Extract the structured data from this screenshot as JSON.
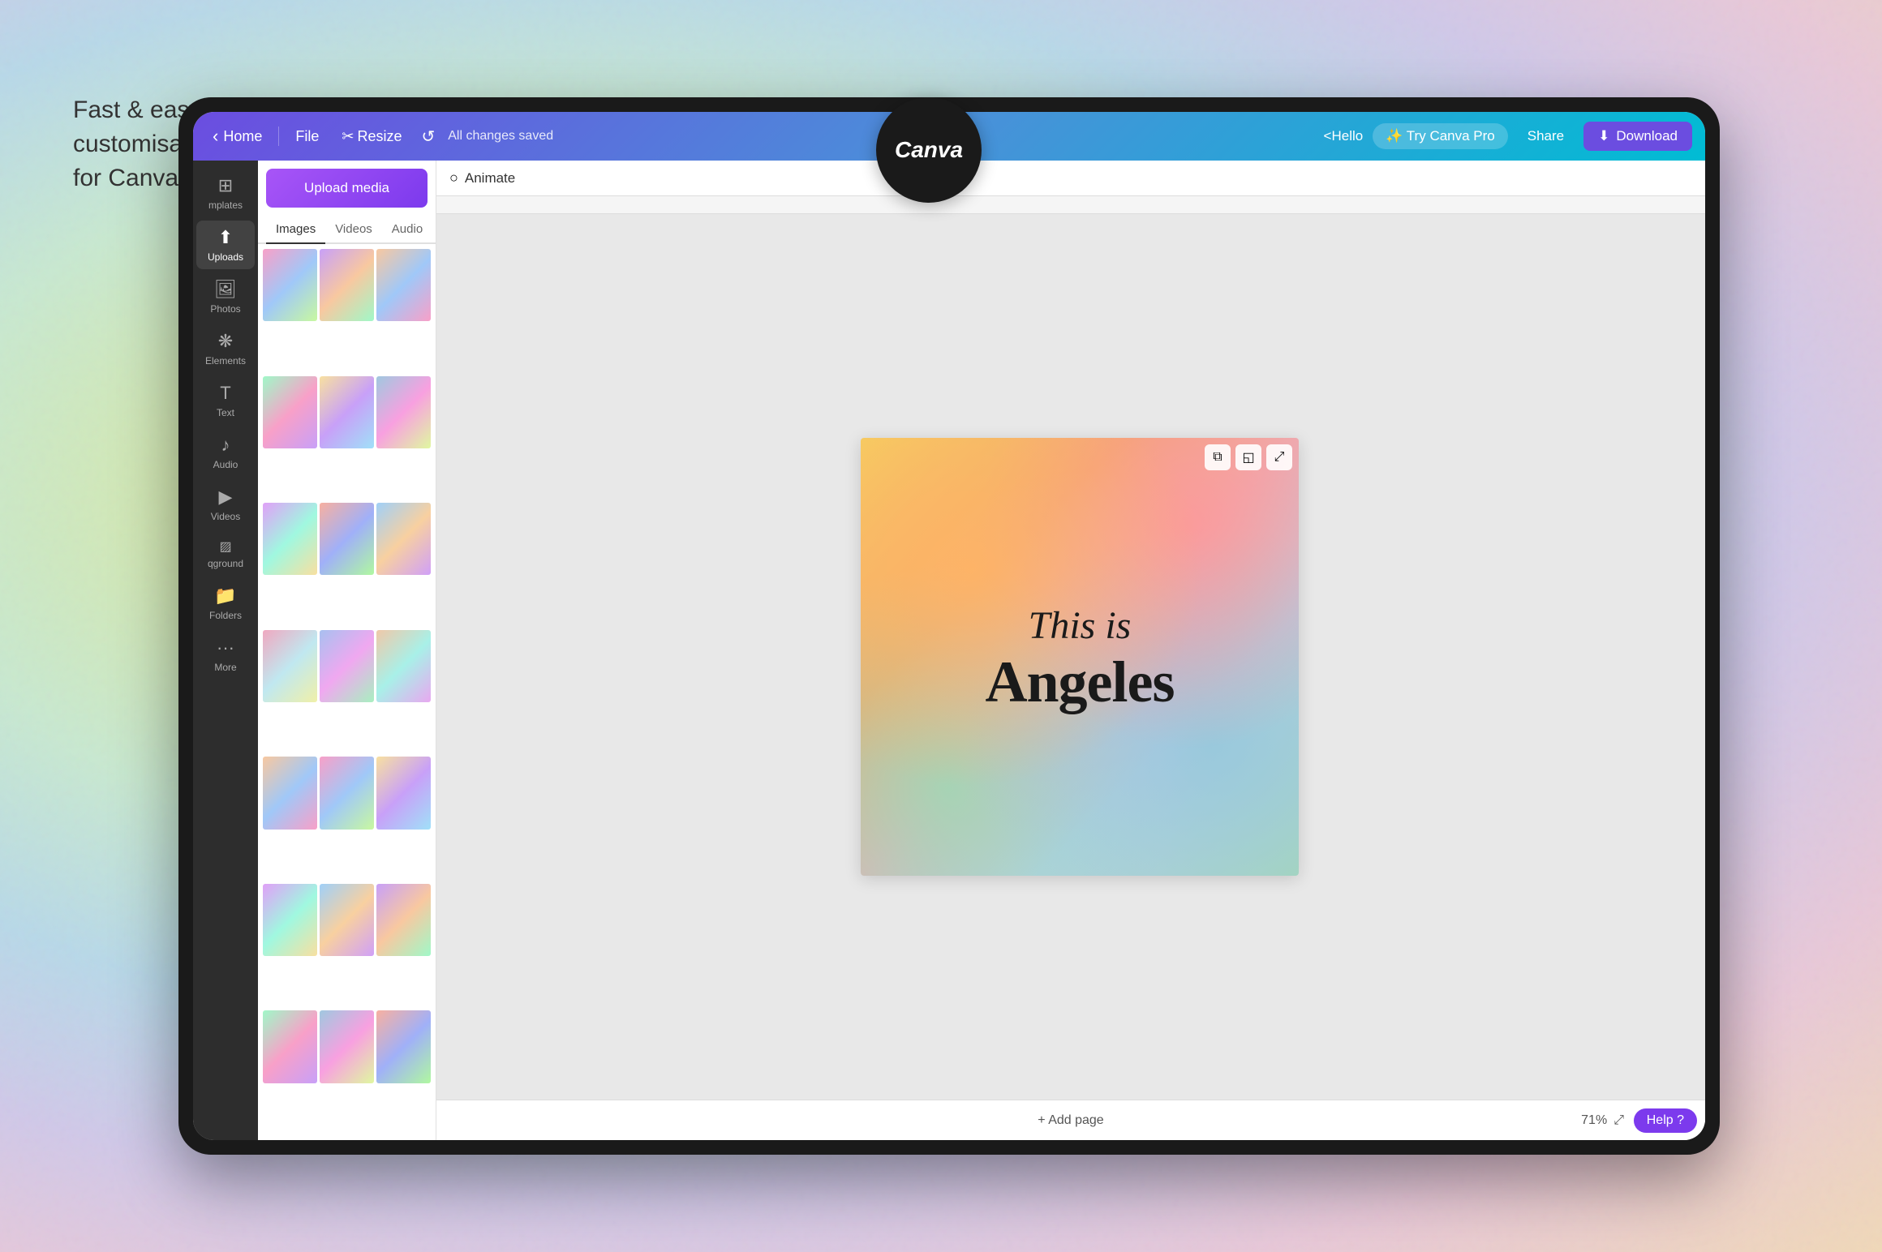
{
  "tagline": {
    "line1": "Fast & easy",
    "line2": "customisation",
    "line3": "for Canva lovers"
  },
  "canva_logo": {
    "text": "Canva"
  },
  "header": {
    "home_label": "Home",
    "file_label": "File",
    "resize_label": "Resize",
    "saved_label": "All changes saved",
    "hello_label": "<Hello",
    "try_pro_label": "✨ Try Canva Pro",
    "share_label": "Share",
    "download_label": "Download"
  },
  "sidebar": {
    "items": [
      {
        "label": "mplates",
        "icon": "⊞"
      },
      {
        "label": "Uploads",
        "icon": "⬆",
        "active": true
      },
      {
        "label": "Photos",
        "icon": "🖼"
      },
      {
        "label": "Elements",
        "icon": "❋"
      },
      {
        "label": "Text",
        "icon": "T"
      },
      {
        "label": "Audio",
        "icon": "♪"
      },
      {
        "label": "Videos",
        "icon": "▶"
      },
      {
        "label": "qground",
        "icon": "////"
      },
      {
        "label": "Folders",
        "icon": "📁"
      },
      {
        "label": "More",
        "icon": "···"
      }
    ]
  },
  "upload_panel": {
    "upload_btn_label": "Upload media",
    "tabs": [
      "Images",
      "Videos",
      "Audio"
    ],
    "active_tab": "Images"
  },
  "animate_bar": {
    "label": "Animate"
  },
  "canvas": {
    "text_line1": "This is",
    "text_line2": "Angeles",
    "add_page_label": "+ Add page",
    "zoom_label": "71%"
  },
  "bottom": {
    "help_label": "Help ?"
  }
}
